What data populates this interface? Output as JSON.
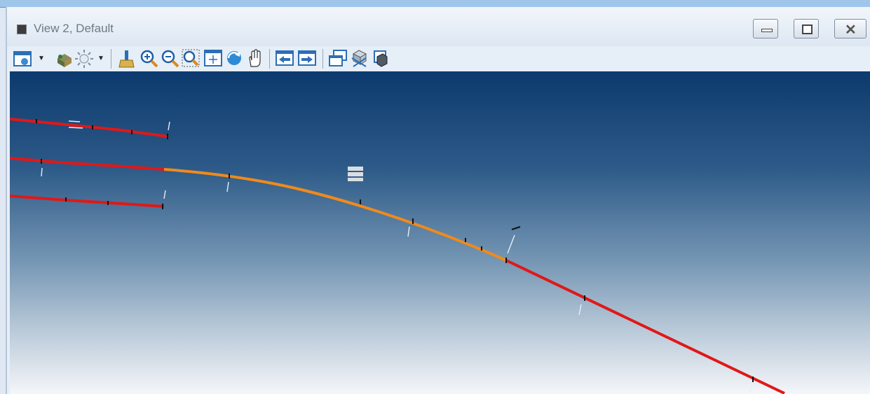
{
  "window": {
    "title": "View 2, Default",
    "controls": [
      "minimize",
      "maximize",
      "close"
    ]
  },
  "toolbar": {
    "buttons": [
      "view-attributes-icon",
      "display-style-icon",
      "lighting-icon",
      "update-view-icon",
      "zoom-in-icon",
      "zoom-out-icon",
      "window-area-icon",
      "fit-view-icon",
      "rotate-view-icon",
      "pan-view-icon",
      "previous-view-icon",
      "next-view-icon",
      "copy-view-icon",
      "clip-volume-icon",
      "view-perspective-icon"
    ]
  },
  "colors": {
    "alignment_straight": "#e01818",
    "alignment_curve": "#f08a1c",
    "background_top": "#0c3a6e",
    "background_bottom": "#f4f6f9"
  }
}
